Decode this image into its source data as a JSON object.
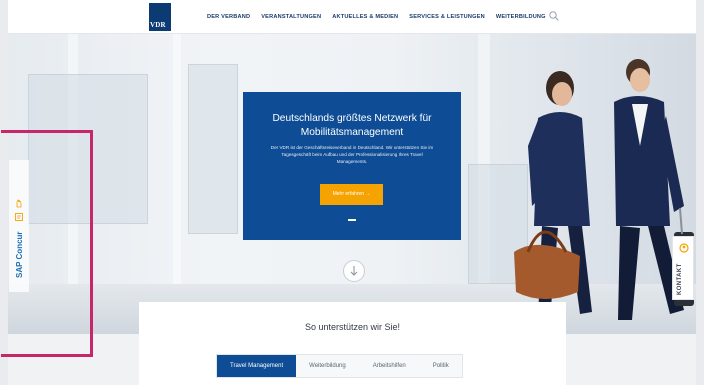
{
  "header": {
    "logo_text": "VDR",
    "nav": [
      "DER VERBAND",
      "VERANSTALTUNGEN",
      "AKTUELLES & MEDIEN",
      "SERVICES & LEISTUNGEN",
      "WEITERBILDUNG"
    ],
    "search_icon": "search-icon"
  },
  "hero": {
    "title": "Deutschlands größtes Netzwerk für Mobilitätsmanagement",
    "text": "Der VDR ist der Geschäftsreiseverband in Deutschland. Wir unterstützen Sie im Tagesgeschäft beim Aufbau und der Professionalisierung Ihres Travel Managements.",
    "button_label": "Mehr erfahren →"
  },
  "section": {
    "title": "So unterstützen wir Sie!",
    "tabs": [
      "Travel Management",
      "Weiterbildung",
      "Arbeitshilfen",
      "Politik"
    ],
    "active_tab": 0
  },
  "side_tabs": {
    "kontakt": "KONTAKT",
    "sap": "SAP Concur"
  },
  "colors": {
    "brand_blue": "#0e4d95",
    "accent_orange": "#f5a300",
    "highlight": "#c8266a"
  }
}
